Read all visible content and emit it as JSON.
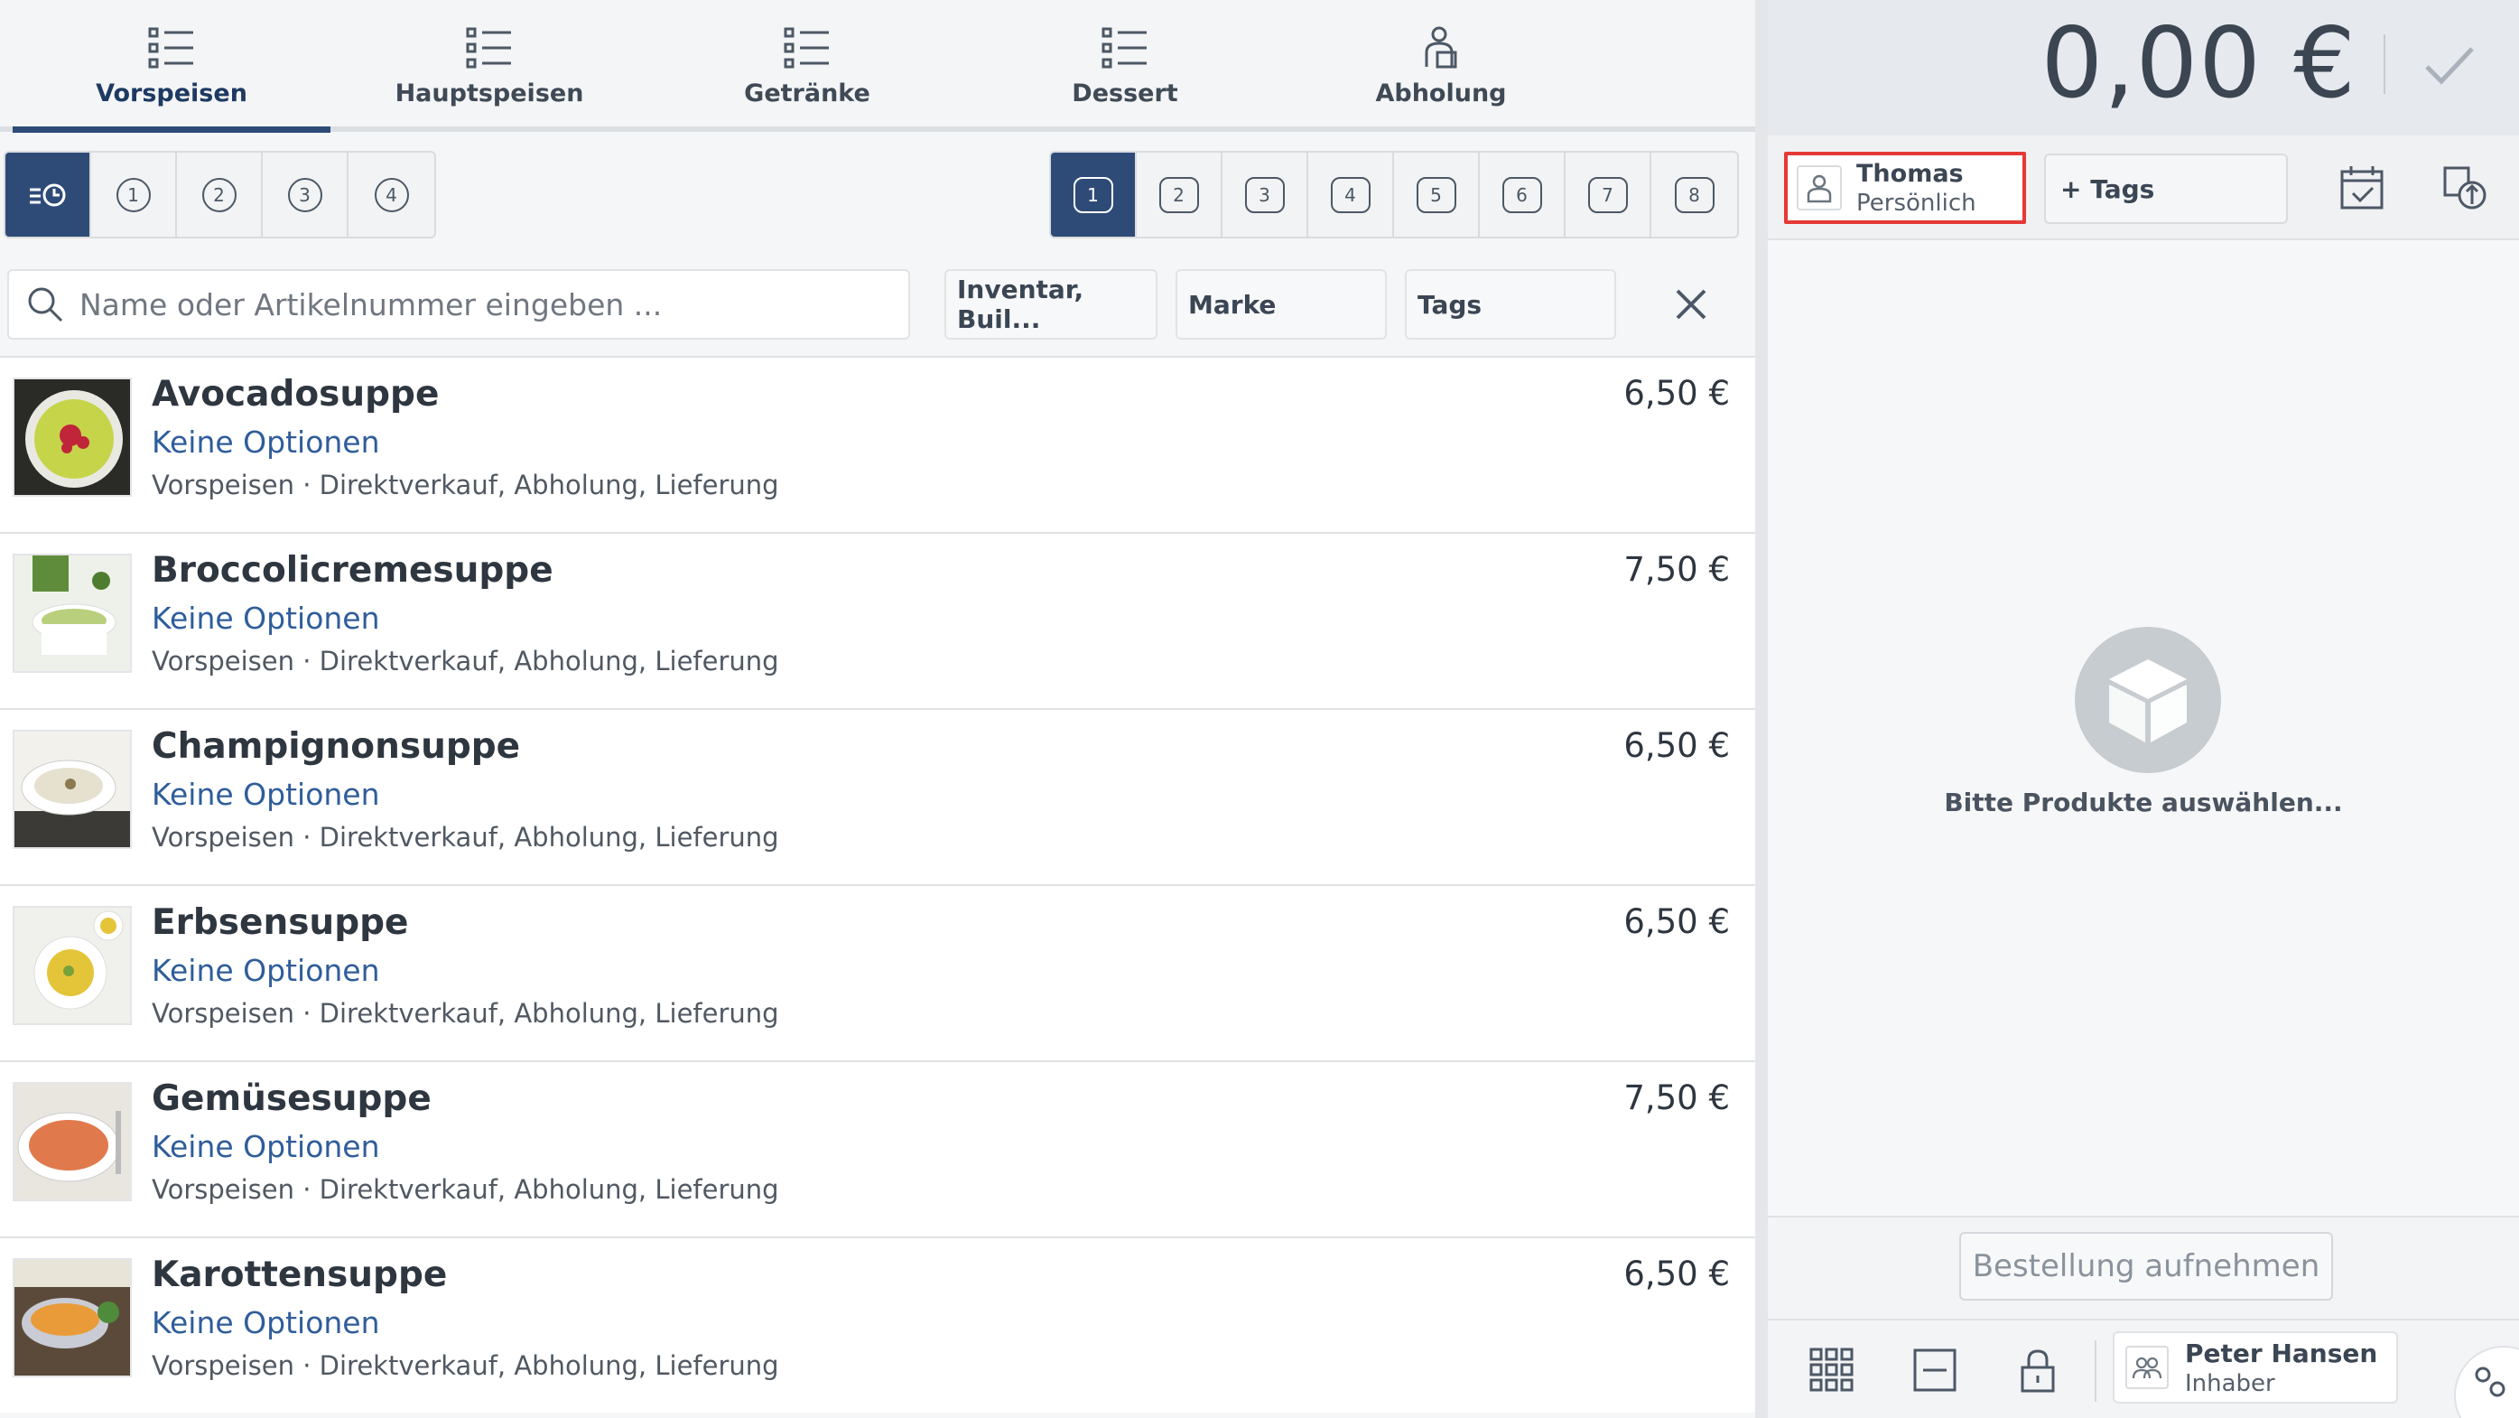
{
  "categories": [
    {
      "label": "Vorspeisen",
      "icon": "list-icon",
      "active": true
    },
    {
      "label": "Hauptspeisen",
      "icon": "list-icon",
      "active": false
    },
    {
      "label": "Getränke",
      "icon": "list-icon",
      "active": false
    },
    {
      "label": "Dessert",
      "icon": "list-icon",
      "active": false
    },
    {
      "label": "Abholung",
      "icon": "pickup-person-icon",
      "active": false
    }
  ],
  "course_selector": {
    "icon": "course-time-icon",
    "items": [
      "1",
      "2",
      "3",
      "4"
    ]
  },
  "seat_selector": {
    "items": [
      "1",
      "2",
      "3",
      "4",
      "5",
      "6",
      "7",
      "8"
    ],
    "active": "1"
  },
  "search": {
    "placeholder": "Name oder Artikelnummer eingeben ..."
  },
  "filters": {
    "inventory": "Inventar, Buil...",
    "brand": "Marke",
    "tags": "Tags"
  },
  "products": [
    {
      "name": "Avocadosuppe",
      "options": "Keine Optionen",
      "meta": "Vorspeisen · Direktverkauf, Abholung, Lieferung",
      "price": "6,50 €"
    },
    {
      "name": "Broccolicremesuppe",
      "options": "Keine Optionen",
      "meta": "Vorspeisen · Direktverkauf, Abholung, Lieferung",
      "price": "7,50 €"
    },
    {
      "name": "Champignonsuppe",
      "options": "Keine Optionen",
      "meta": "Vorspeisen · Direktverkauf, Abholung, Lieferung",
      "price": "6,50 €"
    },
    {
      "name": "Erbsensuppe",
      "options": "Keine Optionen",
      "meta": "Vorspeisen · Direktverkauf, Abholung, Lieferung",
      "price": "6,50 €"
    },
    {
      "name": "Gemüsesuppe",
      "options": "Keine Optionen",
      "meta": "Vorspeisen · Direktverkauf, Abholung, Lieferung",
      "price": "7,50 €"
    },
    {
      "name": "Karottensuppe",
      "options": "Keine Optionen",
      "meta": "Vorspeisen · Direktverkauf, Abholung, Lieferung",
      "price": "6,50 €"
    }
  ],
  "cart": {
    "total": "0,00 €",
    "customer": {
      "name": "Thomas",
      "type": "Persönlich"
    },
    "tags_label": "+  Tags",
    "empty_text": "Bitte Produkte auswählen...",
    "order_button": "Bestellung aufnehmen"
  },
  "user": {
    "name": "Peter Hansen",
    "role": "Inhaber"
  },
  "colors": {
    "accent": "#2e4b78",
    "link": "#2f5d9a",
    "highlight": "#e53935"
  }
}
